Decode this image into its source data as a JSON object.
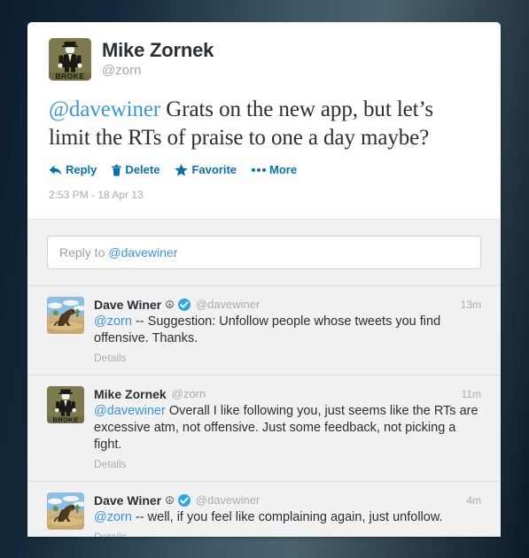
{
  "main_tweet": {
    "author_name": "Mike Zornek",
    "author_handle": "@zorn",
    "avatar_name": "mike-zornek-avatar",
    "text_mention": "@davewiner",
    "text_rest": " Grats on the new app, but let’s limit the RTs of praise to one a day maybe?",
    "actions": [
      {
        "label": "Reply",
        "icon": "reply-arrow-icon"
      },
      {
        "label": "Delete",
        "icon": "trash-icon"
      },
      {
        "label": "Favorite",
        "icon": "star-icon"
      },
      {
        "label": "More",
        "icon": "ellipsis-icon"
      }
    ],
    "timestamp": "2:53 PM - 18 Apr 13"
  },
  "reply_box": {
    "placeholder_prefix": "Reply to",
    "placeholder_mention": "@davewiner"
  },
  "conversation": {
    "details_label": "Details",
    "replies": [
      {
        "author_name": "Dave Winer",
        "author_handle": "@davewiner",
        "avatar_name": "dave-winer-avatar",
        "verified": true,
        "peace_glyph": "☮",
        "time": "13m",
        "mention": "@zorn",
        "text": " -- Suggestion: Unfollow people whose tweets you find offensive. Thanks."
      },
      {
        "author_name": "Mike Zornek",
        "author_handle": "@zorn",
        "avatar_name": "mike-zornek-avatar",
        "verified": false,
        "peace_glyph": "",
        "time": "11m",
        "mention": "@davewiner",
        "text": " Overall I like following you, just seems like the RTs are excessive atm, not offensive. Just some feedback, not picking a fight."
      },
      {
        "author_name": "Dave Winer",
        "author_handle": "@davewiner",
        "avatar_name": "dave-winer-avatar",
        "verified": true,
        "peace_glyph": "☮",
        "time": "4m",
        "mention": "@zorn",
        "text": " -- well, if you feel like complaining again, just unfollow."
      }
    ]
  },
  "colors": {
    "link_blue": "#3b94d9",
    "action_blue": "#0a70a8",
    "verified_blue": "#2eaae1",
    "text_dark": "#292f33",
    "muted_gray": "#a8aeb2",
    "page_backdrop": "#12283a",
    "replies_bg": "#f1f1f1"
  }
}
